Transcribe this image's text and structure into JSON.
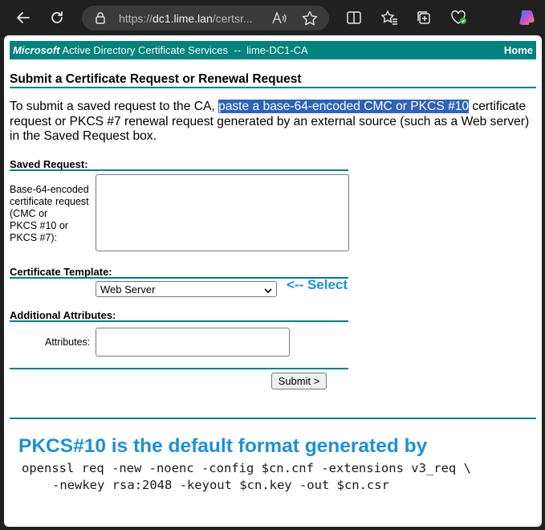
{
  "browser": {
    "url_prefix": "https://",
    "url_host": "dc1.lime.lan",
    "url_path": "/certsr..."
  },
  "header": {
    "brand": "Microsoft",
    "service": "Active Directory Certificate Services",
    "separator": "--",
    "ca_name": "lime-DC1-CA",
    "home_link": "Home"
  },
  "page": {
    "title": "Submit a Certificate Request or Renewal Request",
    "intro_before": "To submit a saved request to the CA, ",
    "intro_highlight": "paste a base-64-encoded CMC or PKCS #10",
    "intro_after": " certificate request or PKCS #7 renewal request generated by an external source (such as a Web server) in the Saved Request box."
  },
  "saved_request": {
    "section_label": "Saved Request:",
    "field_label_lines": [
      "Base-64-encoded",
      "certificate request",
      "(CMC or",
      "PKCS #10 or",
      "PKCS #7):"
    ],
    "value": ""
  },
  "template": {
    "section_label": "Certificate Template:",
    "selected": "Web Server",
    "annotation": "<-- Select"
  },
  "additional": {
    "section_label": "Additional Attributes:",
    "attributes_label": "Attributes:",
    "value": ""
  },
  "submit_label": "Submit >",
  "note": {
    "headline": "PKCS#10 is the default format generated by",
    "code_line1": "openssl req -new -noenc -config $cn.cnf -extensions v3_req \\",
    "code_line2": "-newkey rsa:2048 -keyout $cn.key -out $cn.csr"
  },
  "colors": {
    "teal": "#00827f",
    "highlight": "#2f62b8",
    "annotation_blue": "#1e90d6"
  }
}
